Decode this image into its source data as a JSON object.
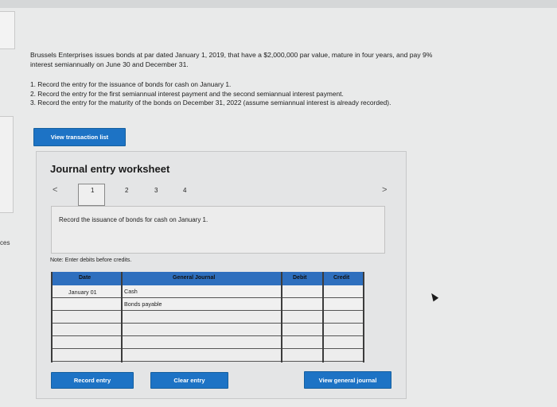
{
  "side_text": "ces",
  "problem": {
    "line1": "Brussels Enterprises issues bonds at par dated January 1, 2019, that have a $2,000,000 par value, mature in four years, and pay 9%",
    "line2": "interest semiannually on June 30 and December 31.",
    "tasks": [
      "1. Record the entry for the issuance of bonds for cash on January 1.",
      "2. Record the entry for the first semiannual interest payment and the second semiannual interest payment.",
      "3. Record the entry for the maturity of the bonds on December 31, 2022 (assume semiannual interest is already recorded)."
    ]
  },
  "buttons": {
    "view_transactions": "View transaction list",
    "record": "Record entry",
    "clear": "Clear entry",
    "view_general": "View general journal"
  },
  "worksheet": {
    "title": "Journal entry worksheet",
    "prev": "<",
    "next": ">",
    "pages": [
      "1",
      "2",
      "3",
      "4"
    ],
    "description": "Record the issuance of bonds for cash on January 1.",
    "note": "Note: Enter debits before credits.",
    "headers": {
      "date": "Date",
      "journal": "General Journal",
      "debit": "Debit",
      "credit": "Credit"
    },
    "rows": [
      {
        "date": "January 01",
        "account": "Cash",
        "debit": "",
        "credit": ""
      },
      {
        "date": "",
        "account": "Bonds payable",
        "debit": "",
        "credit": ""
      },
      {
        "date": "",
        "account": "",
        "debit": "",
        "credit": ""
      },
      {
        "date": "",
        "account": "",
        "debit": "",
        "credit": ""
      },
      {
        "date": "",
        "account": "",
        "debit": "",
        "credit": ""
      },
      {
        "date": "",
        "account": "",
        "debit": "",
        "credit": ""
      }
    ]
  }
}
